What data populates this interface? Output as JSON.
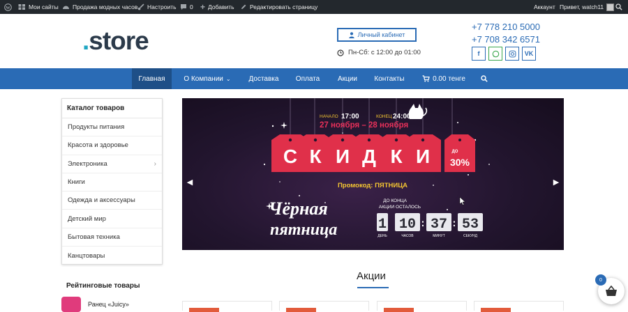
{
  "admin_bar": {
    "my_sites": "Мои сайты",
    "site_name": "Продажа модных часов",
    "customize": "Настроить",
    "comments_count": "0",
    "add_new": "Добавить",
    "edit_page": "Редактировать страницу",
    "account": "Аккаунт",
    "greeting": "Привет, watch11"
  },
  "header": {
    "logo_dot": ".",
    "logo_text": "store",
    "cabinet_label": "Личный кабинет",
    "hours": "Пн-Сб: с 12:00 до 01:00",
    "phones": [
      "+7 778 210 5000",
      "+7 708 342 6571"
    ],
    "social": [
      "f",
      "W",
      "IG",
      "VK"
    ]
  },
  "nav": {
    "items": [
      "Главная",
      "О Компании",
      "Доставка",
      "Оплата",
      "Акции",
      "Контакты"
    ],
    "cart": "0.00 тенге"
  },
  "sidebar": {
    "catalog_title": "Каталог товаров",
    "categories": [
      "Продукты питания",
      "Красота и здоровье",
      "Электроника",
      "Книги",
      "Одежда и аксессуары",
      "Детский мир",
      "Бытовая техника",
      "Канцтовары"
    ],
    "rated_title": "Рейтинговые товары",
    "rated_item": "Ранец «Juicy»"
  },
  "banner": {
    "start_label": "НАЧАЛО",
    "start_time": "17:00",
    "end_label": "КОНЕЦ",
    "end_time": "24:00",
    "dates": "27 ноября – 28 ноября",
    "sale_letters": [
      "С",
      "К",
      "И",
      "Д",
      "К",
      "И"
    ],
    "up_to": "ДО",
    "percent": "30%",
    "promo": "Промокод: ПЯТНИЦА",
    "line1": "Чёрная",
    "line2": "пятница",
    "countdown_title_1": "ДО КОНЦА",
    "countdown_title_2": "АКЦИИ ОСТАЛОСЬ",
    "days": "1",
    "hours": "10",
    "minutes": "37",
    "seconds": "53",
    "days_label": "ДЕНЬ",
    "hours_label": "ЧАСОВ",
    "minutes_label": "МИНУТ",
    "seconds_label": "СЕКУНД"
  },
  "main": {
    "actions_title": "Акции"
  },
  "cart_widget": {
    "count": "0"
  },
  "colors": {
    "brand_blue": "#2a6bb5",
    "nav_active": "#1e4f87",
    "tag_red": "#e0304a",
    "promo_yellow": "#f4c531"
  }
}
